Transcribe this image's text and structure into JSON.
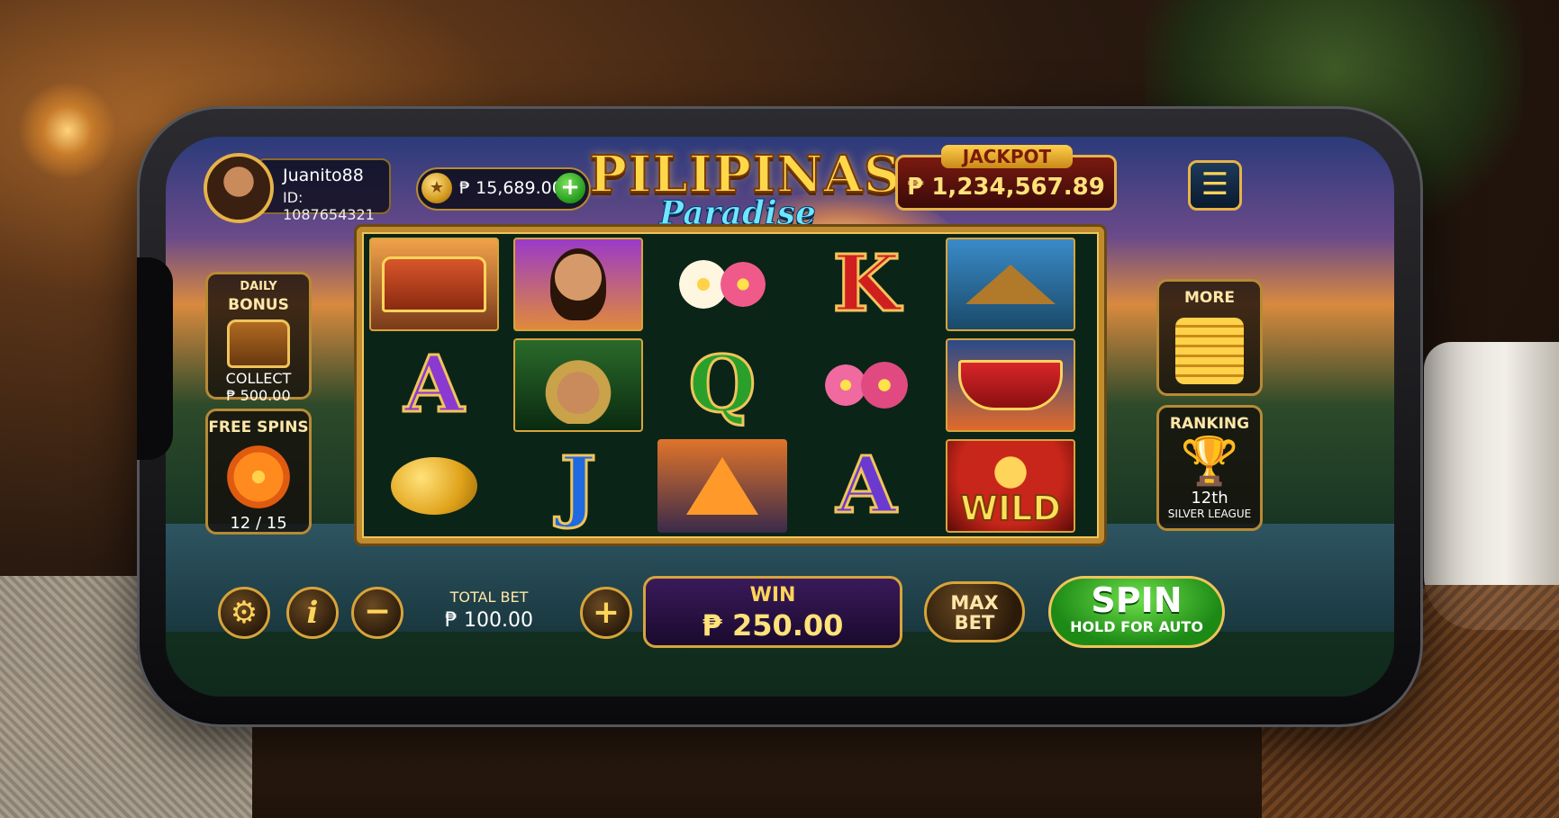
{
  "player": {
    "name": "Juanito88",
    "id": "ID: 1087654321"
  },
  "balance": {
    "amount": "₱ 15,689.00",
    "add_icon": "plus-icon",
    "coin_icon": "coin-icon"
  },
  "logo": {
    "main": "PILIPINAS",
    "sub": "Paradise"
  },
  "jackpot": {
    "label": "JACKPOT",
    "value": "₱ 1,234,567.89"
  },
  "menu": {
    "icon": "hamburger-menu-icon",
    "glyph": "☰"
  },
  "daily_bonus": {
    "title_top": "DAILY",
    "title": "BONUS",
    "action": "COLLECT",
    "amount": "₱ 500.00"
  },
  "free_spins": {
    "title": "FREE SPINS",
    "count": "12 / 15"
  },
  "more": {
    "title": "MORE"
  },
  "ranking": {
    "title": "RANKING",
    "rank": "12th",
    "league": "SILVER LEAGUE"
  },
  "reels": [
    [
      "jeepney",
      "A",
      "mango"
    ],
    [
      "filipina-woman",
      "filipino-man",
      "J"
    ],
    [
      "plumeria-flowers",
      "Q",
      "sailboat"
    ],
    [
      "K",
      "pink-flowers",
      "A"
    ],
    [
      "nipa-hut",
      "festival-boat",
      "WILD"
    ]
  ],
  "controls": {
    "settings_icon": "gear-icon",
    "info_glyph": "i",
    "minus_glyph": "−",
    "plus_glyph": "+",
    "total_bet_label": "TOTAL BET",
    "total_bet_value": "₱ 100.00",
    "win_label": "WIN",
    "win_value": "₱ 250.00",
    "max_bet_line1": "MAX",
    "max_bet_line2": "BET",
    "spin_label": "SPIN",
    "spin_sub": "HOLD FOR AUTO"
  },
  "colors": {
    "gold": "#d8a43a",
    "spin_green": "#249a1c",
    "win_purple": "#3a1a5a",
    "jackpot_red": "#7a1a10"
  }
}
